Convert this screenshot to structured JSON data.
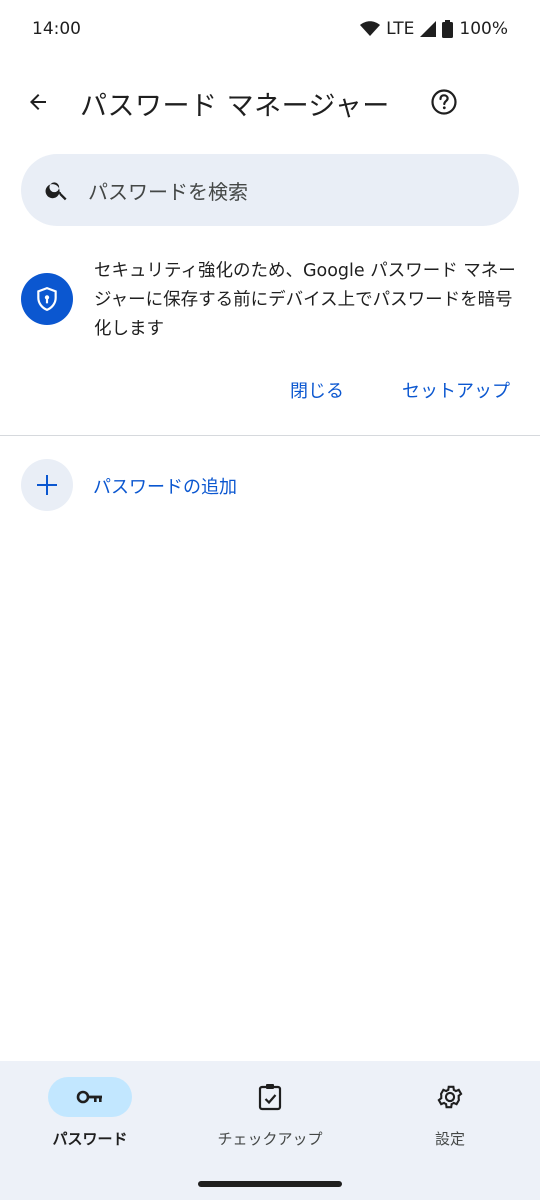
{
  "status_bar": {
    "time": "14:00",
    "network": "LTE",
    "battery": "100%",
    "icons": [
      "wifi-icon",
      "signal-icon",
      "battery-icon"
    ]
  },
  "app_bar": {
    "title": "パスワード マネージャー",
    "back_icon": "back-arrow-icon",
    "help_icon": "help-icon"
  },
  "search": {
    "placeholder": "パスワードを検索",
    "icon": "search-icon"
  },
  "notice": {
    "icon": "shield-lock-icon",
    "text": "セキュリティ強化のため、Google パスワード マネージャーに保存する前にデバイス上でパスワードを暗号化します",
    "close_label": "閉じる",
    "setup_label": "セットアップ"
  },
  "add_password": {
    "icon": "plus-icon",
    "label": "パスワードの追加"
  },
  "bottom_nav": {
    "items": [
      {
        "label": "パスワード",
        "icon": "key-icon",
        "active": true
      },
      {
        "label": "チェックアップ",
        "icon": "clipboard-check-icon",
        "active": false
      },
      {
        "label": "設定",
        "icon": "gear-icon",
        "active": false
      }
    ]
  },
  "colors": {
    "accent": "#0b57d0",
    "search_bg": "#e9eef6",
    "nav_bg": "#edf1f8",
    "active_pill": "#c2e7ff"
  }
}
